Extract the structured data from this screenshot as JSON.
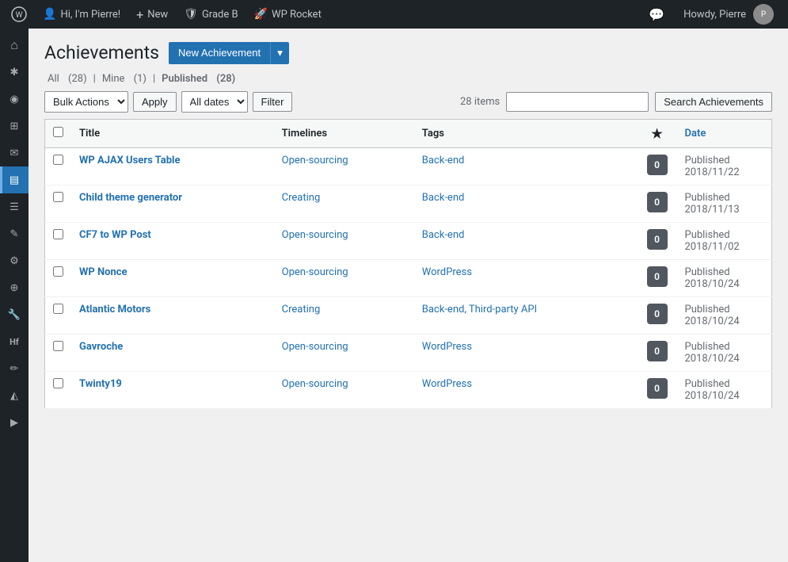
{
  "adminbar": {
    "logo": "⊞",
    "user_greeting": "Hi, I'm Pierre!",
    "new_label": "New",
    "grade_b_label": "Grade B",
    "wp_rocket_label": "WP Rocket",
    "howdy_label": "Howdy, Pierre"
  },
  "sidebar": {
    "items": [
      {
        "icon": "⌂",
        "label": "Dashboard",
        "active": false
      },
      {
        "icon": "✱",
        "label": "Posts",
        "active": false
      },
      {
        "icon": "◉",
        "label": "Media",
        "active": false
      },
      {
        "icon": "⊞",
        "label": "Pages",
        "active": false
      },
      {
        "icon": "✉",
        "label": "Comments",
        "active": false
      },
      {
        "icon": "▤",
        "label": "Achievements",
        "active": true
      },
      {
        "icon": "☰",
        "label": "Menu",
        "active": false
      },
      {
        "icon": "✎",
        "label": "Tools",
        "active": false
      },
      {
        "icon": "⚙",
        "label": "Settings",
        "active": false
      },
      {
        "icon": "⊕",
        "label": "Users",
        "active": false
      },
      {
        "icon": "🔧",
        "label": "Plugins",
        "active": false
      },
      {
        "icon": "H",
        "label": "Hf",
        "active": false
      },
      {
        "icon": "✏",
        "label": "Edit",
        "active": false
      },
      {
        "icon": "◭",
        "label": "Shield",
        "active": false
      },
      {
        "icon": "▶",
        "label": "Play",
        "active": false
      }
    ]
  },
  "page": {
    "title": "Achievements",
    "new_achievement_btn": "New Achievement",
    "dropdown_arrow": "▾"
  },
  "filters": {
    "all_label": "All",
    "all_count": "(28)",
    "mine_label": "Mine",
    "mine_count": "(1)",
    "published_label": "Published",
    "published_count": "(28)",
    "bulk_actions_default": "Bulk Actions",
    "apply_label": "Apply",
    "all_dates_default": "All dates",
    "filter_label": "Filter",
    "items_count": "28 items",
    "search_placeholder": "",
    "search_btn_label": "Search Achievements"
  },
  "table": {
    "columns": [
      {
        "key": "title",
        "label": "Title"
      },
      {
        "key": "timelines",
        "label": "Timelines"
      },
      {
        "key": "tags",
        "label": "Tags"
      },
      {
        "key": "star",
        "label": "★"
      },
      {
        "key": "date",
        "label": "Date"
      }
    ],
    "rows": [
      {
        "title": "WP AJAX Users Table",
        "timelines": "Open-sourcing",
        "tags": "Back-end",
        "badge": "0",
        "status": "Published",
        "date": "2018/11/22"
      },
      {
        "title": "Child theme generator",
        "timelines": "Creating",
        "tags": "Back-end",
        "badge": "0",
        "status": "Published",
        "date": "2018/11/13"
      },
      {
        "title": "CF7 to WP Post",
        "timelines": "Open-sourcing",
        "tags": "Back-end",
        "badge": "0",
        "status": "Published",
        "date": "2018/11/02"
      },
      {
        "title": "WP Nonce",
        "timelines": "Open-sourcing",
        "tags": "WordPress",
        "badge": "0",
        "status": "Published",
        "date": "2018/10/24"
      },
      {
        "title": "Atlantic Motors",
        "timelines": "Creating",
        "tags": "Back-end, Third-party API",
        "badge": "0",
        "status": "Published",
        "date": "2018/10/24"
      },
      {
        "title": "Gavroche",
        "timelines": "Open-sourcing",
        "tags": "WordPress",
        "badge": "0",
        "status": "Published",
        "date": "2018/10/24"
      },
      {
        "title": "Twinty19",
        "timelines": "Open-sourcing",
        "tags": "WordPress",
        "badge": "0",
        "status": "Published",
        "date": "2018/10/24"
      }
    ]
  }
}
